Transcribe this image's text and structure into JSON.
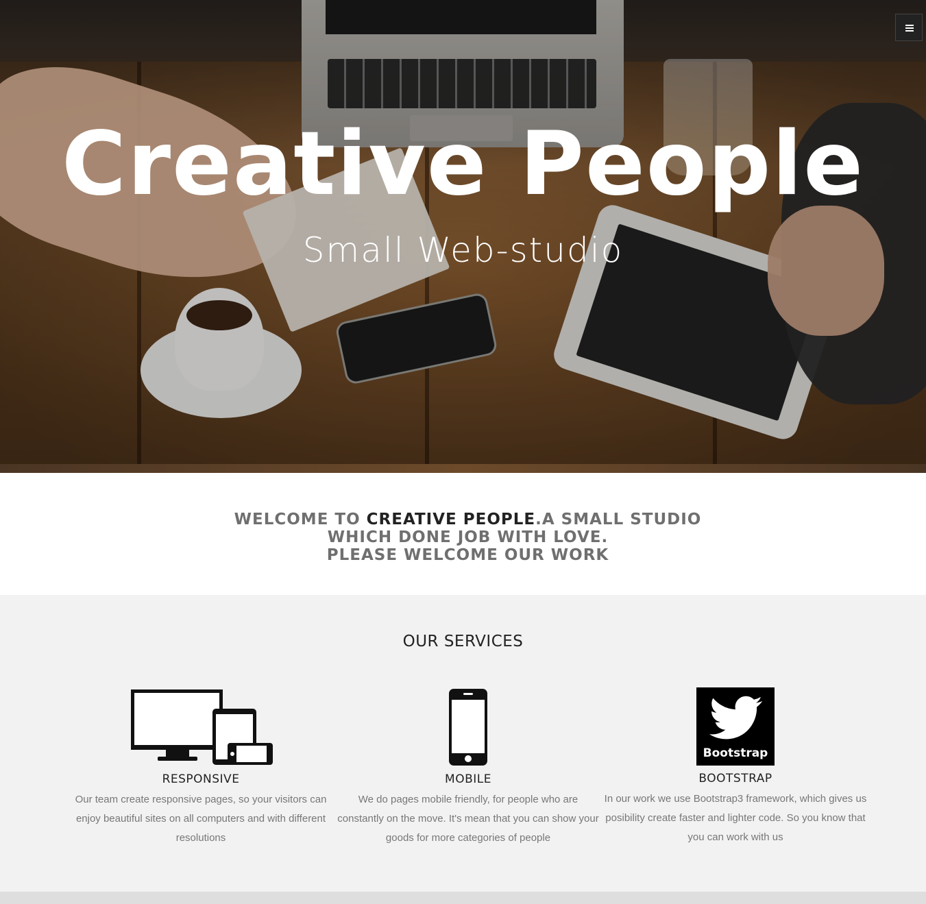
{
  "hero": {
    "title": "Creative People",
    "subtitle": "Small Web-studio",
    "menu_icon": "hamburger-menu-icon"
  },
  "welcome": {
    "part1": "WELCOME TO ",
    "brand": "CREATIVE PEOPLE",
    "part2": ".A SMALL STUDIO WHICH DONE JOB WITH LOVE.",
    "line2": "PLEASE WELCOME OUR WORK"
  },
  "services": {
    "title": "OUR SERVICES",
    "items": [
      {
        "name": "RESPONSIVE",
        "icon": "responsive-devices-icon",
        "desc": "Our team create responsive pages, so your visitors can enjoy beautiful sites on all computers and with different resolutions"
      },
      {
        "name": "MOBILE",
        "icon": "mobile-phone-icon",
        "desc": "We do pages mobile friendly, for people who are constantly on the move. It's mean that you can show your goods for more categories of people"
      },
      {
        "name": "BOOTSTRAP",
        "icon": "bootstrap-twitter-icon",
        "icon_text": "Bootstrap",
        "desc": "In our work we use Bootstrap3 framework, which gives us posibility create faster and lighter code. So you know that you can work with us"
      }
    ]
  }
}
